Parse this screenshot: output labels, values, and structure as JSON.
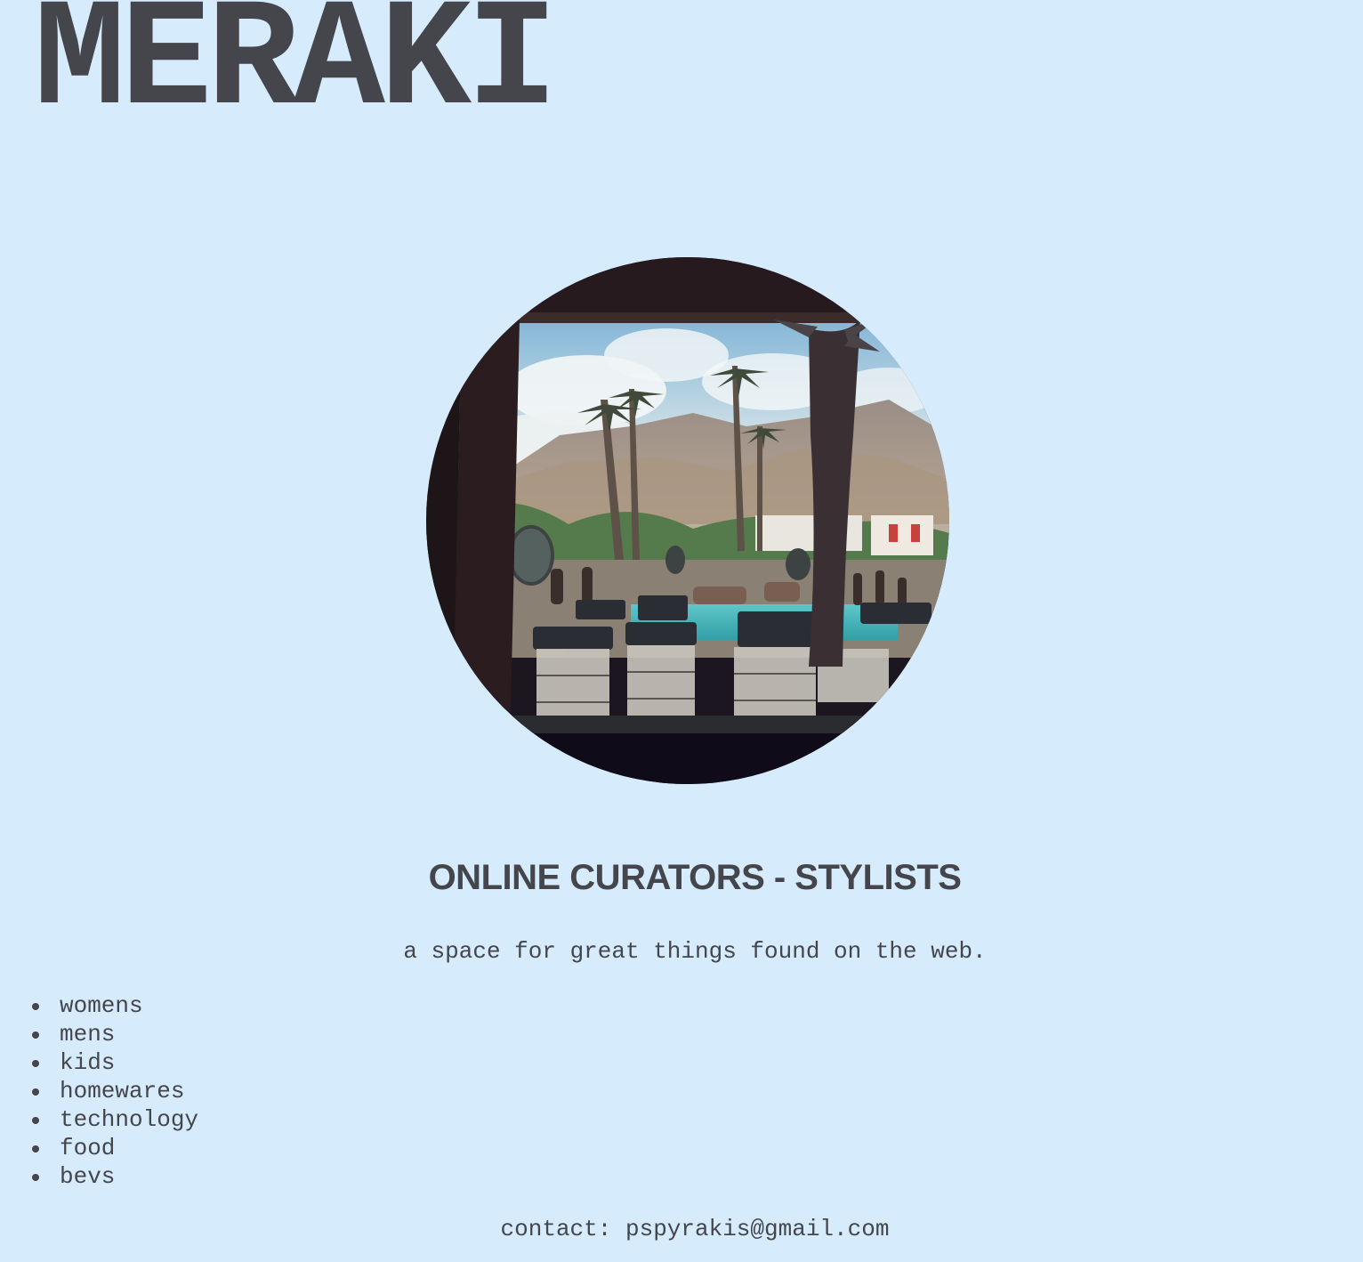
{
  "site": {
    "logo_text": "MERAKI",
    "headline": "ONLINE CURATORS - STYLISTS",
    "tagline": "a space for great things found on the web."
  },
  "hero_image": {
    "alt": "palm trees by a pool with mountains",
    "shape": "circle"
  },
  "nav": {
    "items": [
      {
        "label": "womens"
      },
      {
        "label": "mens"
      },
      {
        "label": "kids"
      },
      {
        "label": "homewares"
      },
      {
        "label": "technology"
      },
      {
        "label": "food"
      },
      {
        "label": "bevs"
      }
    ]
  },
  "contact": {
    "prefix": "contact:",
    "email": "pspyrakis@gmail.com"
  },
  "colors": {
    "background": "#d6ecfd",
    "text": "#45454c"
  }
}
